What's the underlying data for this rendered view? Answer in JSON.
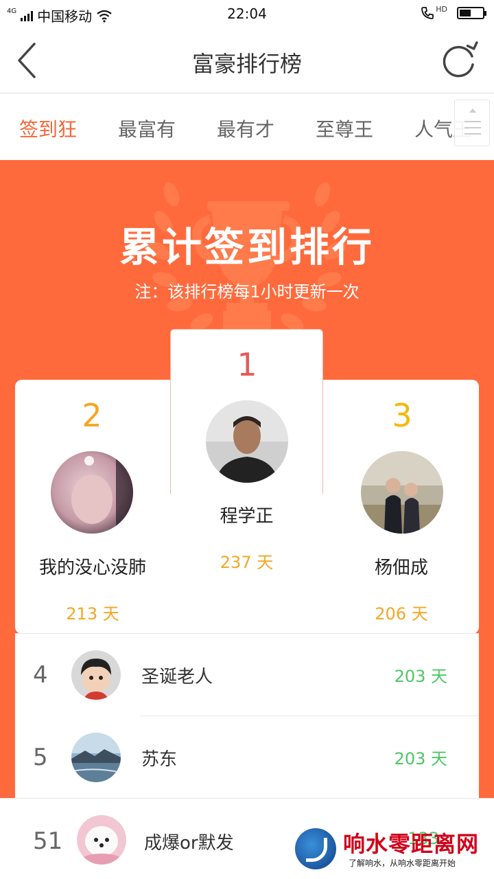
{
  "status_bar": {
    "network": "4G",
    "carrier": "中国移动",
    "time": "22:04",
    "hd": "HD",
    "battery_level": 0.5
  },
  "header": {
    "title": "富豪排行榜",
    "back_icon": "chevron-left-icon",
    "refresh_icon": "refresh-icon"
  },
  "tabs": [
    {
      "label": "签到狂",
      "active": true
    },
    {
      "label": "最富有",
      "active": false
    },
    {
      "label": "最有才",
      "active": false
    },
    {
      "label": "至尊王",
      "active": false
    },
    {
      "label": "人气王",
      "active": false
    }
  ],
  "banner": {
    "title": "累计签到排行",
    "note": "注：该排行榜每1小时更新一次"
  },
  "top3": [
    {
      "rank": "1",
      "name": "程学正",
      "days": "237 天"
    },
    {
      "rank": "2",
      "name": "我的没心没肺",
      "days": "213 天"
    },
    {
      "rank": "3",
      "name": "杨佃成",
      "days": "206 天"
    }
  ],
  "list": [
    {
      "rank": "4",
      "name": "圣诞老人",
      "days": "203 天"
    },
    {
      "rank": "5",
      "name": "苏东",
      "days": "203 天"
    }
  ],
  "my_rank": {
    "rank": "51",
    "name": "成爆or默发",
    "days": "133"
  },
  "watermark": {
    "title": "响水零距离网",
    "subtitle": "了解响水，从响水零距离开始"
  },
  "colors": {
    "accent": "#ff6a3d",
    "active_tab": "#f66437",
    "gold": "#f5a623",
    "green": "#4cc765",
    "rank1": "#e85a5a",
    "rank2": "#f5a623",
    "rank3": "#f5b800"
  }
}
